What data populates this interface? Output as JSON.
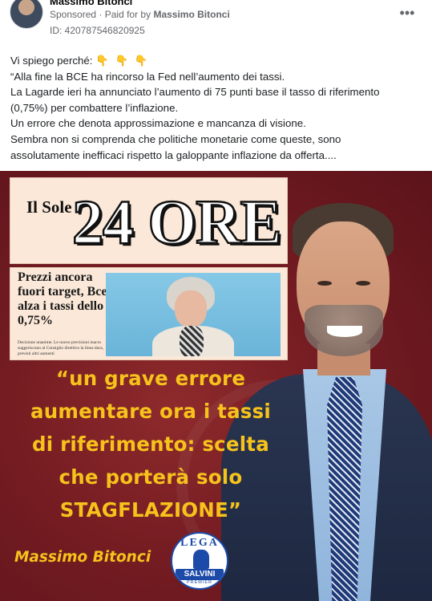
{
  "post": {
    "author": "Massimo Bitonci",
    "sponsored": "Sponsored",
    "paid_for_prefix": "Paid for by",
    "paid_for_by": "Massimo Bitonci",
    "ad_id": "ID: 420787546820925",
    "more_icon": "more-options-icon",
    "text_lines": [
      "Vi spiego perché:",
      "“Alla fine la BCE ha rincorso la Fed nell’aumento dei tassi.",
      "La Lagarde ieri ha annunciato l’aumento di 75 punti base il tasso di riferimento",
      "(0,75%) per combattere l’inflazione.",
      "Un errore che denota approssimazione e mancanza di visione.",
      "Sembra non si comprenda che politiche monetarie come queste, sono",
      "assolutamente inefficaci rispetto la galoppante inflazione da offerta...."
    ],
    "emoji": "👇 👇 👇"
  },
  "creative": {
    "newspaper_name_a": "Il Sole",
    "newspaper_name_b": "24 ORE",
    "headline": "Prezzi ancora fuori target, Bce alza i tassi dello 0,75%",
    "caption": "Decisione unanime. Le nuove previsioni macro suggeriscono al Consiglio direttivo la linea dura, previsti altri aumenti",
    "quote_lines": [
      "“un grave errore",
      "aumentare ora i tassi",
      "di riferimento: scelta",
      "che porterà solo",
      "STAGFLAZIONE”"
    ],
    "signature": "Massimo Bitonci",
    "logo": {
      "top": "LEGA",
      "band": "SALVINI",
      "bottom": "PREMIER"
    },
    "colors": {
      "background": "#741c22",
      "quote": "#f6c21c",
      "logo_blue": "#1c4aa8"
    }
  }
}
